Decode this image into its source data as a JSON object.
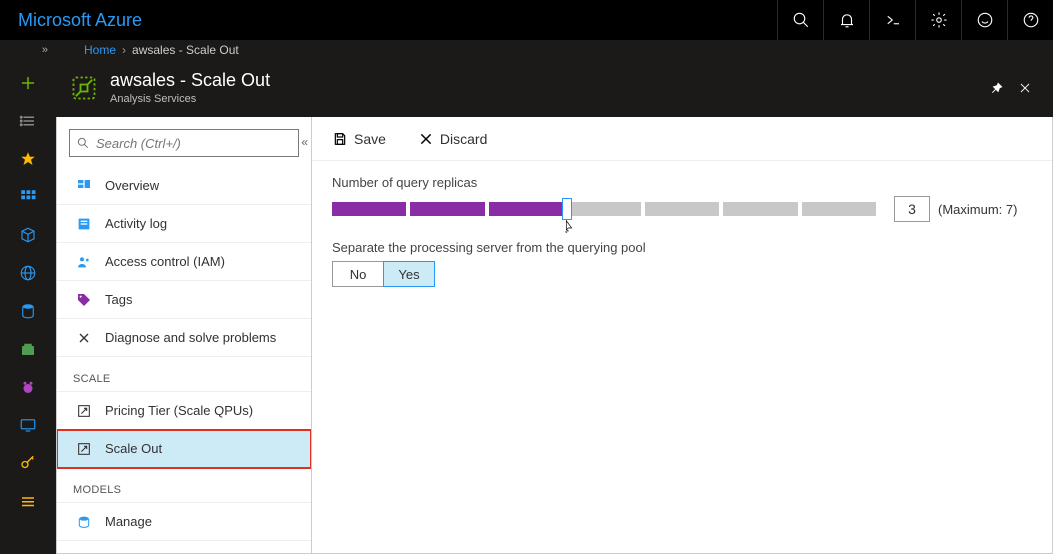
{
  "topbar": {
    "logo": "Microsoft Azure"
  },
  "breadcrumb": {
    "home": "Home",
    "current": "awsales - Scale Out"
  },
  "blade": {
    "title": "awsales - Scale Out",
    "subtitle": "Analysis Services"
  },
  "search": {
    "placeholder": "Search (Ctrl+/)"
  },
  "menu": {
    "overview": "Overview",
    "activity": "Activity log",
    "iam": "Access control (IAM)",
    "tags": "Tags",
    "diag": "Diagnose and solve problems",
    "section_scale": "SCALE",
    "pricing": "Pricing Tier (Scale QPUs)",
    "scaleout": "Scale Out",
    "section_models": "MODELS",
    "manage": "Manage"
  },
  "cmd": {
    "save": "Save",
    "discard": "Discard"
  },
  "pane": {
    "replicas_label": "Number of query replicas",
    "replicas_value": "3",
    "replicas_max": "(Maximum: 7)",
    "sep_label": "Separate the processing server from the querying pool",
    "no": "No",
    "yes": "Yes"
  }
}
